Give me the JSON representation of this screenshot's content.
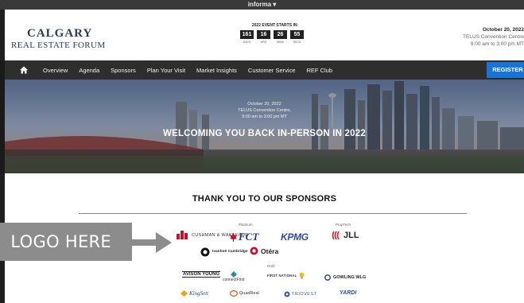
{
  "topbar": {
    "brand": "informa ▾"
  },
  "header": {
    "logo_line1": "CALGARY",
    "logo_line2": "REAL ESTATE FORUM",
    "countdown": {
      "title": "2022 EVENT STARTS IN:",
      "units": [
        {
          "value": "161",
          "label": "DAYS"
        },
        {
          "value": "16",
          "label": "HRS"
        },
        {
          "value": "26",
          "label": "MINS"
        },
        {
          "value": "55",
          "label": "SECS"
        }
      ]
    },
    "event": {
      "date": "October 20, 2022",
      "venue": "TELUS Convention Centre",
      "time": "9:00 am to 3:00 pm MT"
    }
  },
  "nav": {
    "home_icon": "home-icon",
    "items": [
      "Overview",
      "Agenda",
      "Sponsors",
      "Plan Your Visit",
      "Market Insights",
      "Customer Service",
      "REF Club"
    ],
    "register_label": "REGISTER",
    "register_color": "#1a73d9"
  },
  "hero": {
    "date": "October 20, 2022",
    "venue": "TELUS Convention Centre,",
    "time": "9:00 am to 3:00 pm MT",
    "title": "WELCOMING YOU BACK IN-PERSON IN 2022"
  },
  "sponsors": {
    "heading": "THANK YOU TO OUR SPONSORS",
    "tiers": {
      "platinum": "Platinum",
      "proptech": "PropTech",
      "gold": "Gold"
    },
    "logos": {
      "cushman": "CUSHMAN & WAKEFIELD",
      "fct": "FCT",
      "kpmg": "KPMG",
      "jll": "JLL",
      "ivanhoe": "Ivanhoé Cambridge",
      "otera": "Otéra",
      "avison": "AVISON YOUNG",
      "connectfirst": "connectFirst",
      "firstnational": "FIRST NATIONAL",
      "gowling": "GOWLING WLG",
      "kingsett": "KingSett",
      "quadreal": "QuadReal",
      "triovest": "TRIOVEST",
      "yardi": "YARDI"
    }
  },
  "overlay": {
    "callout_text": "LOGO HERE",
    "callout_color": "#8c8c8c"
  }
}
